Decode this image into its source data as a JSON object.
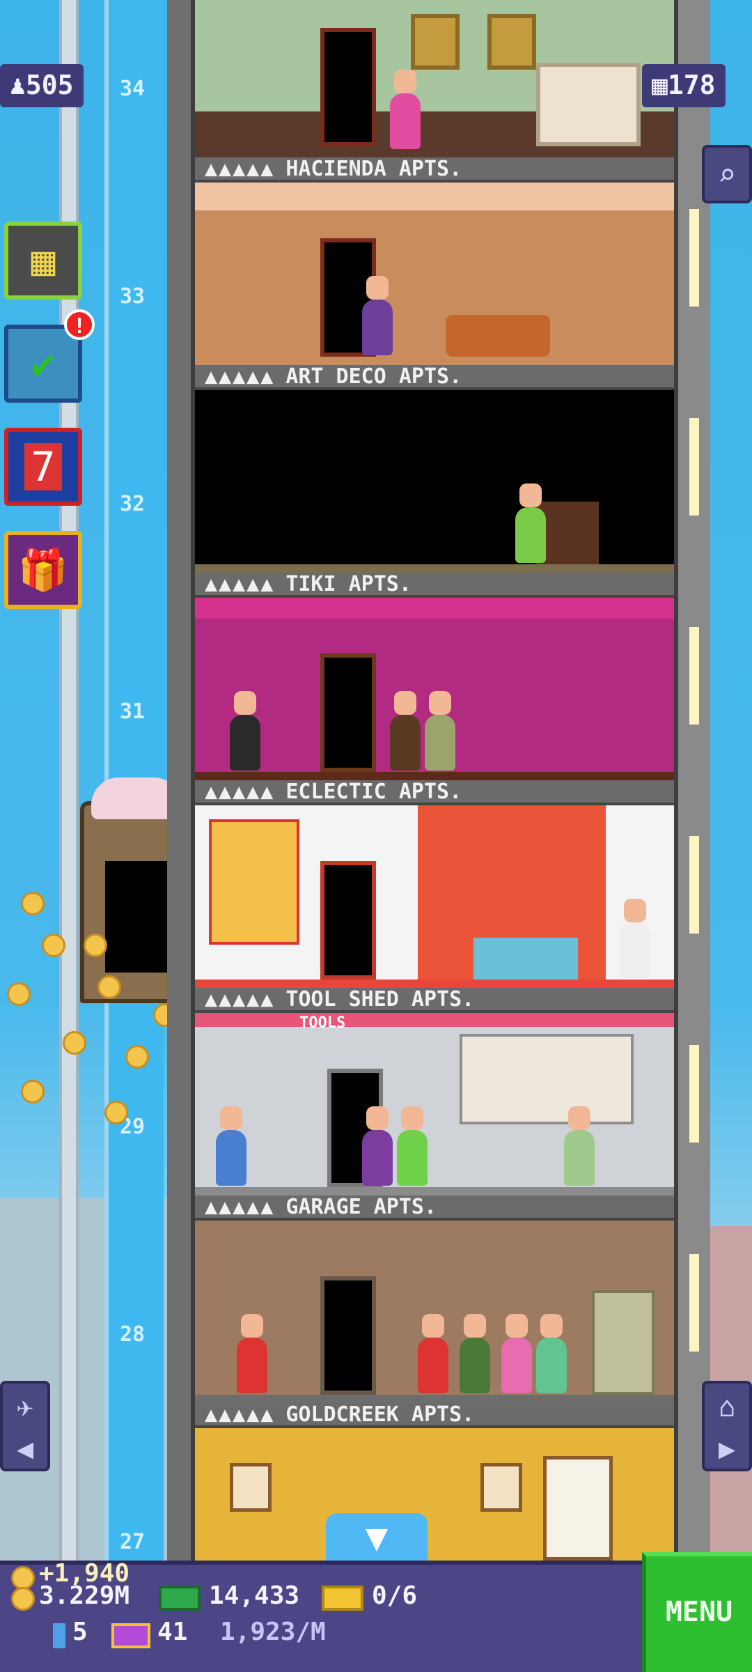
{
  "top": {
    "population": "505",
    "floors_count": "178"
  },
  "side_buttons": [
    {
      "name": "build-floor-icon",
      "glyph": "▦"
    },
    {
      "name": "missions-icon",
      "glyph": "✔",
      "badge": "!"
    },
    {
      "name": "calendar-icon",
      "glyph": "7"
    },
    {
      "name": "gift-icon",
      "glyph": "🎁"
    }
  ],
  "floor_numbers": [
    "34",
    "33",
    "32",
    "31",
    "29",
    "28",
    "27"
  ],
  "floors": [
    {
      "stars": "▲▲▲▲▲",
      "name": "HACIENDA APTS."
    },
    {
      "stars": "▲▲▲▲▲",
      "name": "ART DECO APTS."
    },
    {
      "stars": "▲▲▲▲▲",
      "name": "TIKI APTS."
    },
    {
      "stars": "▲▲▲▲▲",
      "name": "ECLECTIC APTS."
    },
    {
      "stars": "▲▲▲▲▲",
      "name": "TOOL SHED APTS."
    },
    {
      "stars": "▲▲▲▲▲",
      "name": "GARAGE APTS."
    },
    {
      "stars": "▲▲▲▲▲",
      "name": "GOLDCREEK APTS."
    }
  ],
  "room_signs": {
    "tools": "TOOLS"
  },
  "bottom": {
    "coin_gain": "+1,940",
    "coins": "3.229M",
    "bux": "14,433",
    "tickets": "0/6",
    "bitizens_blue": "5",
    "vip": "41",
    "income_rate": "1,923/M",
    "menu_label": "MENU"
  },
  "colors": {
    "bar": "#4c4687",
    "menu": "#2dbf2f",
    "shaft": "#3eb8ef"
  }
}
